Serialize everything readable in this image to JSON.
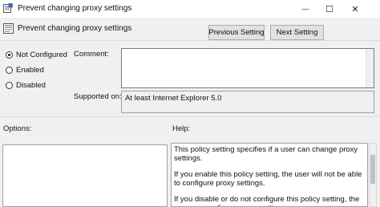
{
  "window": {
    "title": "Prevent changing proxy settings",
    "controls": [
      "minimize",
      "maximize",
      "close"
    ],
    "minimize_glyph": "—",
    "maximize_glyph": "☐",
    "close_glyph": "✕"
  },
  "header": {
    "setting_name": "Prevent changing proxy settings",
    "previous_label": "Previous Setting",
    "next_label": "Next Setting"
  },
  "state": {
    "options": [
      {
        "label": "Not Configured",
        "checked": true
      },
      {
        "label": "Enabled",
        "checked": false
      },
      {
        "label": "Disabled",
        "checked": false
      }
    ]
  },
  "comment": {
    "label": "Comment:",
    "value": ""
  },
  "supported": {
    "label": "Supported on:",
    "value": "At least Internet Explorer 5.0"
  },
  "panels": {
    "options_label": "Options:",
    "help_label": "Help:"
  },
  "help": {
    "paragraphs": [
      "This policy setting specifies if a user can change proxy settings.",
      "If you enable this policy setting, the user will not be able to configure proxy settings.",
      "If you disable or do not configure this policy setting, the user can configure proxy settings."
    ]
  },
  "colors": {
    "window_bg": "#f0f0f0",
    "titlebar_bg": "#ffffff",
    "textbox_border": "#7a7a7a"
  },
  "icons": {
    "title": "policy-window-icon",
    "setting": "policy-setting-icon"
  }
}
